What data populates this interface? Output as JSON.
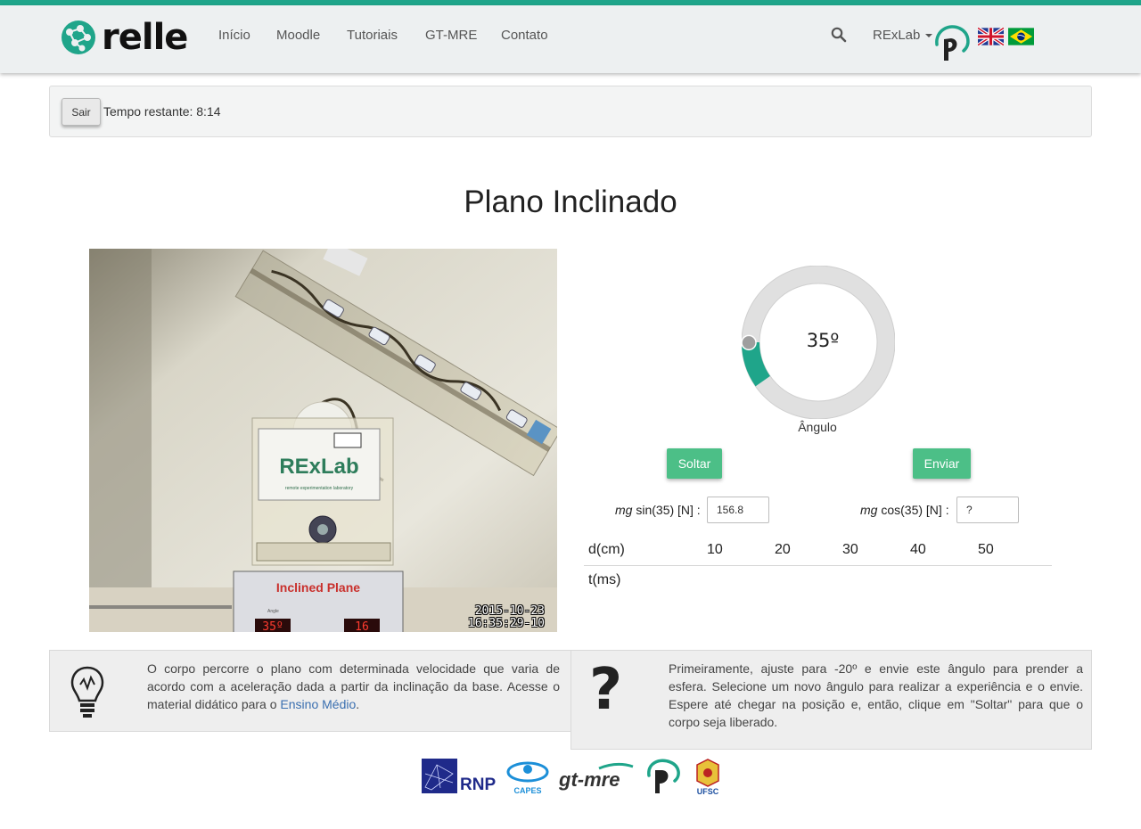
{
  "nav": {
    "brand": "relle",
    "links": [
      "Início",
      "Moodle",
      "Tutoriais",
      "GT-MRE",
      "Contato"
    ],
    "user_menu": "RExLab"
  },
  "session": {
    "exit_label": "Sair",
    "timer_text": "Tempo restante: 8:14"
  },
  "page_title": "Plano Inclinado",
  "camera": {
    "timestamp_date": "2015-10-23",
    "timestamp_time": "16:35:29-10",
    "panel_title": "RExLab",
    "panel_subtitle": "remote experimentation laboratory",
    "base_label": "Inclined Plane",
    "base_display_left": "35º",
    "base_display_right": "16",
    "base_small_left": "Angle",
    "base_small_right": "Height\nor Fall Time"
  },
  "angle_control": {
    "value": 35,
    "display": "35º",
    "label": "Ângulo",
    "accent": "#1fa58a"
  },
  "buttons": {
    "release": "Soltar",
    "send": "Enviar"
  },
  "forces": {
    "sin_label_italic": "mg",
    "sin_label_rest": " sin(35) [N] :",
    "sin_value": "156.8",
    "cos_label_italic": "mg",
    "cos_label_rest": " cos(35) [N] :",
    "cos_value": "?"
  },
  "table": {
    "d_label": "d(cm)",
    "t_label": "t(ms)",
    "distances": [
      "10",
      "20",
      "30",
      "40",
      "50"
    ],
    "times": [
      "",
      "",
      "",
      "",
      ""
    ]
  },
  "info_left": {
    "text": "O corpo percorre o plano com determinada velocidade que varia de acordo com a aceleração dada a partir da inclinação da base. Acesse o material didático para o ",
    "link": "Ensino Médio",
    "tail": "."
  },
  "info_right": {
    "icon_text": "?",
    "text": "Primeiramente, ajuste para -20º e envie este ângulo para prender a esfera. Selecione um novo ângulo para realizar a experiência e o envie. Espere até chegar na posição e, então, clique em \"Soltar\" para que o corpo seja liberado."
  },
  "footer": {
    "rnp": "RNP",
    "capes": "CAPES",
    "gtmre": "gt-mre",
    "ufsc": "UFSC"
  }
}
